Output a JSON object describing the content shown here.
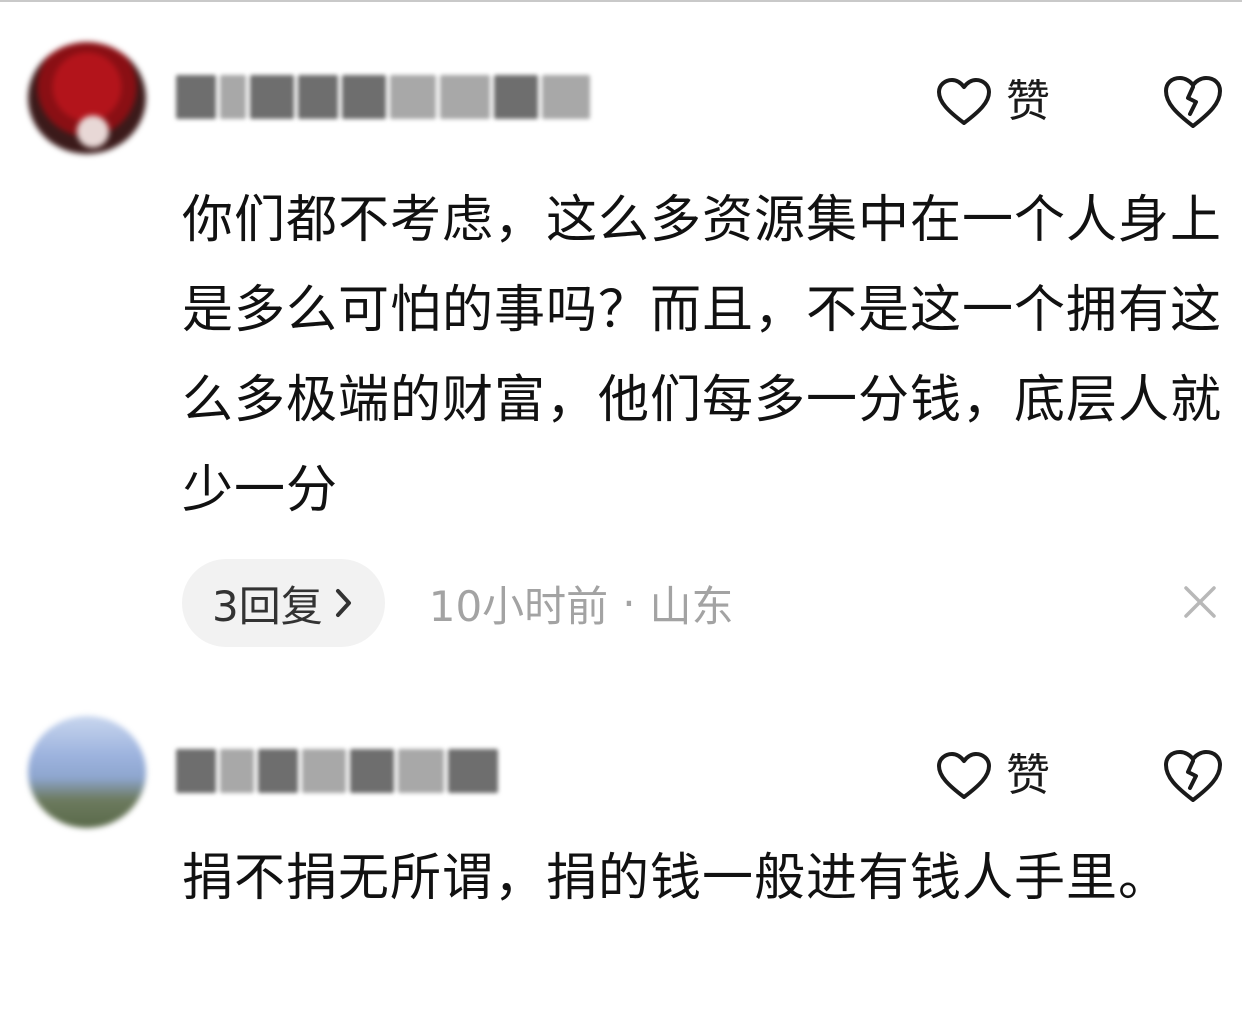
{
  "comments": [
    {
      "like_label": "赞",
      "body": "你们都不考虑，这么多资源集中在一个人身上是多么可怕的事吗？而且，不是这一个拥有这么多极端的财富，他们每多一分钱，底层人就少一分",
      "reply_label": "3回复",
      "time": "10小时前",
      "separator": "·",
      "location": "山东"
    },
    {
      "like_label": "赞",
      "body": "捐不捐无所谓，捐的钱一般进有钱人手里。"
    }
  ],
  "icons": {
    "like": "heart-outline-icon",
    "dislike": "broken-heart-icon",
    "reply_chevron": "chevron-right-icon",
    "close": "close-icon"
  },
  "colors": {
    "text": "#111111",
    "secondary": "#a3a3a3",
    "pill_bg": "#f2f2f2"
  }
}
